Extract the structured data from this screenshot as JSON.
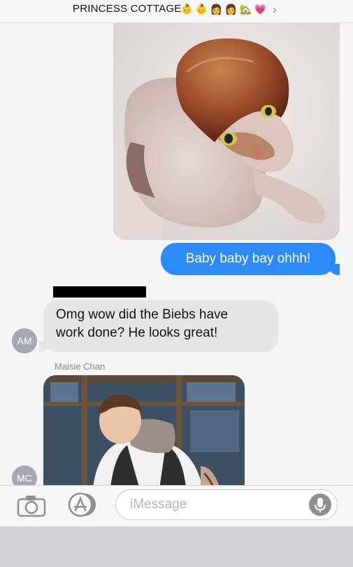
{
  "header": {
    "title": "PRINCESS COTTAGE",
    "emojis": [
      "👶",
      "👶",
      "👩",
      "👩",
      "🏡",
      "💗"
    ],
    "chevron": "›"
  },
  "messages": {
    "outgoing_text": "Baby baby bay ohhh!",
    "incoming_line1": "Omg wow did the Biebs have",
    "incoming_line2": "work done? He looks great!",
    "avatar_am": "AM",
    "avatar_mc": "MC",
    "sender_name": "Maisie Chan"
  },
  "toolbar": {
    "input_placeholder": "iMessage",
    "icons": [
      "camera-icon",
      "app-store-icon",
      "microphone-icon"
    ]
  },
  "colors": {
    "outgoing_bubble": "#2b8af7",
    "incoming_bubble": "#e5e5ea",
    "avatar": "#a4a9b3"
  }
}
